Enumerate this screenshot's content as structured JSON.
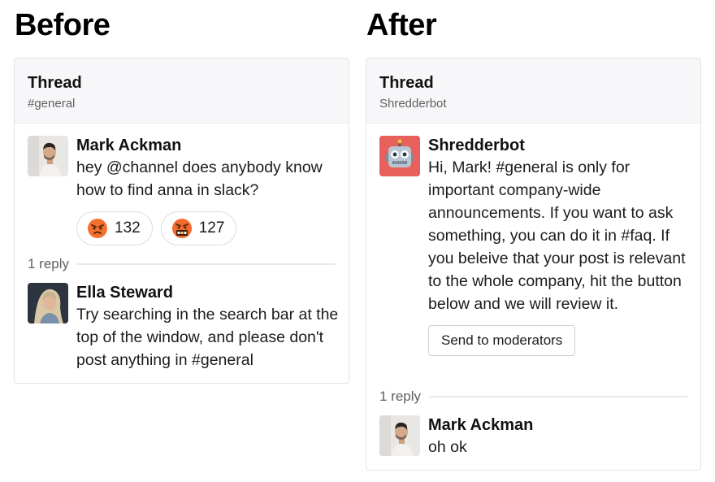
{
  "before": {
    "heading": "Before",
    "thread": {
      "title": "Thread",
      "subtitle": "#general"
    },
    "message": {
      "author": "Mark Ackman",
      "text": "hey @channel does anybody know how to find anna in slack?",
      "reactions": [
        {
          "emoji": "angry-face-icon",
          "count": "132"
        },
        {
          "emoji": "face-with-symbols-on-mouth-icon",
          "count": "127"
        }
      ]
    },
    "reply_count": "1 reply",
    "reply": {
      "author": "Ella Steward",
      "text": "Try searching in the search bar at the top of the window, and please don't post anything in #general"
    }
  },
  "after": {
    "heading": "After",
    "thread": {
      "title": "Thread",
      "subtitle": "Shredderbot"
    },
    "message": {
      "author": "Shredderbot",
      "text": "Hi, Mark! #general is only for important company-wide announcements. If you want to ask something, you can do it in #faq. If you beleive that your post is relevant to the whole company, hit the button below and we will review it.",
      "button_label": "Send to moderators"
    },
    "reply_count": "1 reply",
    "reply": {
      "author": "Mark Ackman",
      "text": "oh ok"
    }
  },
  "colors": {
    "bot_avatar_bg": "#e8605a",
    "header_bg": "#f7f7f9",
    "panel_border": "#e3e3e6"
  }
}
